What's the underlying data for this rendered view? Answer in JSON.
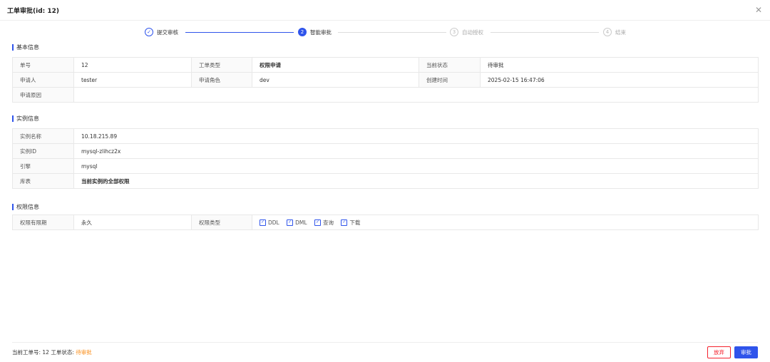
{
  "header": {
    "title": "工单审批(id: 12)",
    "close_icon": "close-icon"
  },
  "steps": [
    {
      "index": "✓",
      "label": "提交审核",
      "state": "done"
    },
    {
      "index": "2",
      "label": "智能审批",
      "state": "active"
    },
    {
      "index": "3",
      "label": "自动授权",
      "state": "wait"
    },
    {
      "index": "4",
      "label": "结束",
      "state": "wait"
    }
  ],
  "basic": {
    "title": "基本信息",
    "order_no_label": "单号",
    "order_no": "12",
    "type_label": "工单类型",
    "type": "权限申请",
    "status_label": "当前状态",
    "status": "待审批",
    "applicant_label": "申请人",
    "applicant": "tester",
    "role_label": "申请角色",
    "role": "dev",
    "created_label": "创建时间",
    "created": "2025-02-15 16:47:06",
    "reason_label": "申请原因",
    "reason": ""
  },
  "instance": {
    "title": "实例信息",
    "name_label": "实例名称",
    "name": "10.18.215.89",
    "id_label": "实例ID",
    "id": "mysql-zlihcz2x",
    "engine_label": "引擎",
    "engine": "mysql",
    "db_label": "库表",
    "db": "当前实例的全部权限"
  },
  "permission": {
    "title": "权限信息",
    "validity_label": "权限有限期",
    "validity": "永久",
    "ptype_label": "权限类型",
    "types": [
      "DDL",
      "DML",
      "查询",
      "下载"
    ]
  },
  "footer": {
    "current_prefix": "当前工单号: 12",
    "status_prefix": "工单状态: ",
    "status_value": "待审批",
    "reject_label": "放弃",
    "approve_label": "审批"
  },
  "colors": {
    "accent": "#2f54eb",
    "warning": "#fa8c16",
    "danger": "#f5222d"
  }
}
